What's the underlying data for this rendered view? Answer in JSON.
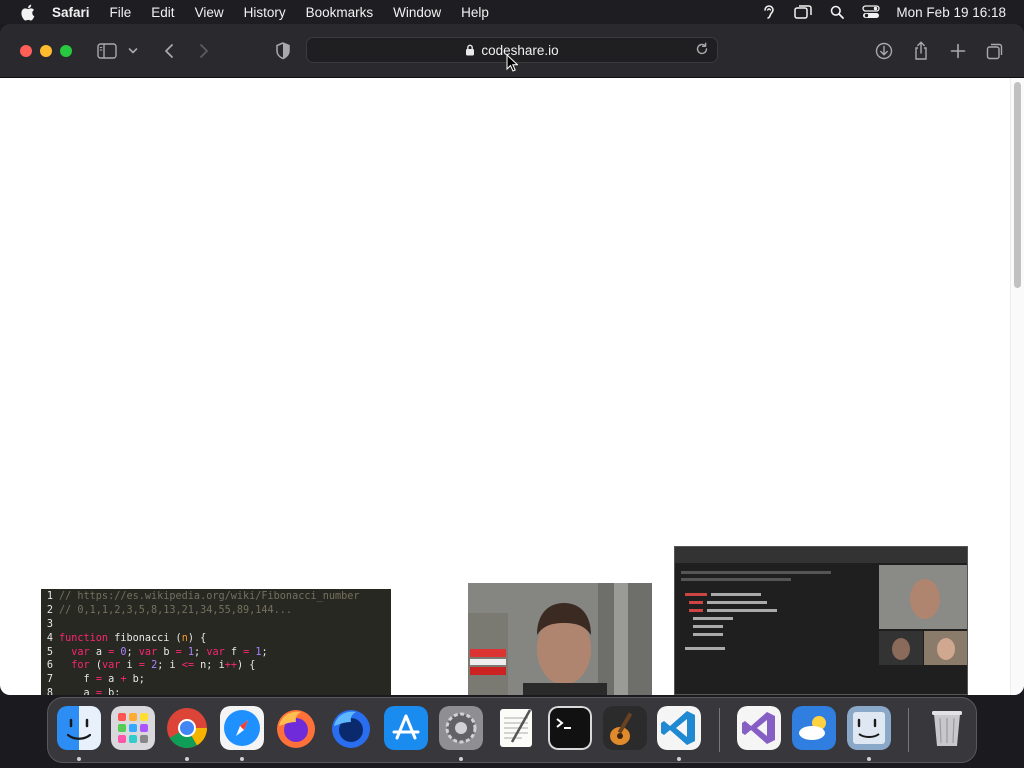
{
  "menubar": {
    "app": "Safari",
    "items": [
      "File",
      "Edit",
      "View",
      "History",
      "Bookmarks",
      "Window",
      "Help"
    ],
    "clock": "Mon Feb 19  16:18"
  },
  "toolbar": {
    "url": "codeshare.io"
  },
  "code": {
    "lines": [
      {
        "n": "1",
        "parts": [
          {
            "c": "cm",
            "t": "// https://es.wikipedia.org/wiki/Fibonacci_number"
          }
        ]
      },
      {
        "n": "2",
        "parts": [
          {
            "c": "cm",
            "t": "// 0,1,1,2,3,5,8,13,21,34,55,89,144..."
          }
        ]
      },
      {
        "n": "3",
        "parts": []
      },
      {
        "n": "4",
        "parts": [
          {
            "c": "kw",
            "t": "function"
          },
          {
            "c": "fn",
            "t": " fibonacci "
          },
          {
            "c": "pl",
            "t": "("
          },
          {
            "c": "ar",
            "t": "n"
          },
          {
            "c": "pl",
            "t": ") {"
          }
        ]
      },
      {
        "n": "5",
        "parts": [
          {
            "c": "pl",
            "t": "  "
          },
          {
            "c": "kw",
            "t": "var"
          },
          {
            "c": "pl",
            "t": " a "
          },
          {
            "c": "kw",
            "t": "="
          },
          {
            "c": "pl",
            "t": " "
          },
          {
            "c": "nm",
            "t": "0"
          },
          {
            "c": "pl",
            "t": "; "
          },
          {
            "c": "kw",
            "t": "var"
          },
          {
            "c": "pl",
            "t": " b "
          },
          {
            "c": "kw",
            "t": "="
          },
          {
            "c": "pl",
            "t": " "
          },
          {
            "c": "nm",
            "t": "1"
          },
          {
            "c": "pl",
            "t": "; "
          },
          {
            "c": "kw",
            "t": "var"
          },
          {
            "c": "pl",
            "t": " f "
          },
          {
            "c": "kw",
            "t": "="
          },
          {
            "c": "pl",
            "t": " "
          },
          {
            "c": "nm",
            "t": "1"
          },
          {
            "c": "pl",
            "t": ";"
          }
        ]
      },
      {
        "n": "6",
        "parts": [
          {
            "c": "pl",
            "t": "  "
          },
          {
            "c": "kw",
            "t": "for"
          },
          {
            "c": "pl",
            "t": " ("
          },
          {
            "c": "kw",
            "t": "var"
          },
          {
            "c": "pl",
            "t": " i "
          },
          {
            "c": "kw",
            "t": "="
          },
          {
            "c": "pl",
            "t": " "
          },
          {
            "c": "nm",
            "t": "2"
          },
          {
            "c": "pl",
            "t": "; i "
          },
          {
            "c": "kw",
            "t": "<="
          },
          {
            "c": "pl",
            "t": " n; i"
          },
          {
            "c": "kw",
            "t": "++"
          },
          {
            "c": "pl",
            "t": ") {"
          }
        ]
      },
      {
        "n": "7",
        "parts": [
          {
            "c": "pl",
            "t": "    f "
          },
          {
            "c": "kw",
            "t": "="
          },
          {
            "c": "pl",
            "t": " a "
          },
          {
            "c": "kw",
            "t": "+"
          },
          {
            "c": "pl",
            "t": " b;"
          }
        ]
      },
      {
        "n": "8",
        "parts": [
          {
            "c": "pl",
            "t": "    a "
          },
          {
            "c": "kw",
            "t": "="
          },
          {
            "c": "pl",
            "t": " b;"
          }
        ]
      }
    ]
  },
  "colors": {
    "menubar": "#1e1e22",
    "toolbar": "#2a2a2e",
    "editor_bg": "#272822",
    "close": "#ff5f57",
    "minimize": "#febc2e",
    "maximize": "#28c840"
  },
  "icons": {
    "apple": "apple-logo-icon",
    "sidebar": "sidebar-icon",
    "back": "chevron-left-icon",
    "forward": "chevron-right-icon",
    "privacy": "shield-icon",
    "download": "download-icon",
    "share": "share-icon",
    "new_tab": "plus-icon",
    "tabs": "tab-overview-icon"
  },
  "dock": {
    "apps": [
      "Finder",
      "Launchpad",
      "Chrome",
      "Safari",
      "Firefox",
      "Firefox Developer Edition",
      "App Store",
      "System Settings",
      "TextEdit",
      "Terminal",
      "GarageBand",
      "Visual Studio Code",
      "Visual Studio",
      "Weather",
      "Preview",
      "Trash"
    ]
  }
}
